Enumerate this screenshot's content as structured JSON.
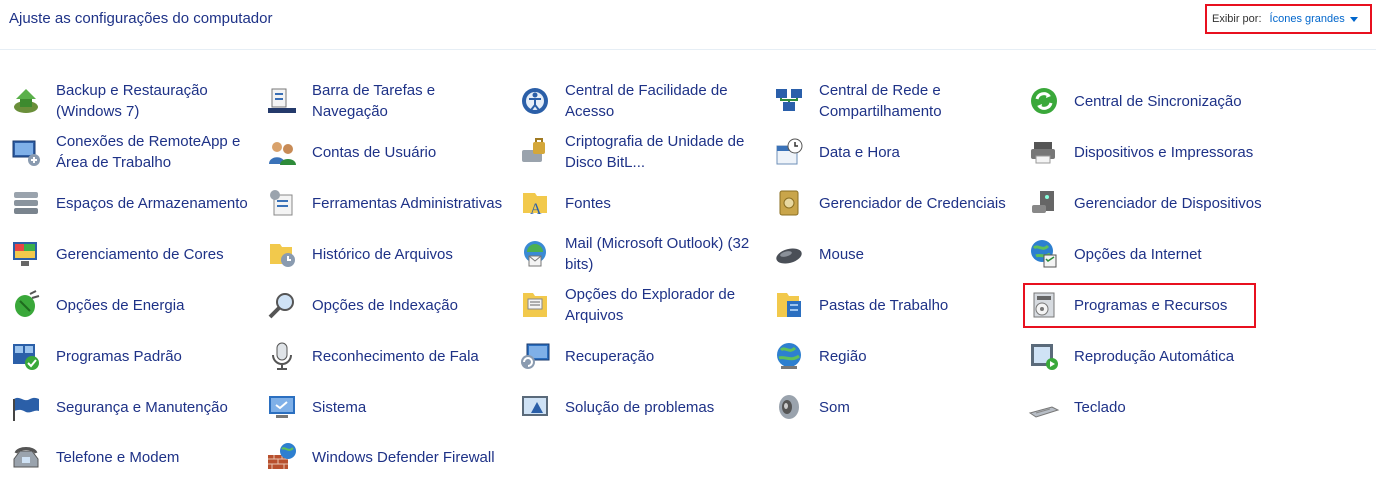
{
  "header": {
    "title": "Ajuste as configurações do computador",
    "view_label": "Exibir por:",
    "view_value": "Ícones grandes"
  },
  "items": [
    {
      "label": "Backup e Restauração (Windows 7)",
      "icon": "backup-restore-icon"
    },
    {
      "label": "Barra de Tarefas e Navegação",
      "icon": "taskbar-icon"
    },
    {
      "label": "Central de Facilidade de Acesso",
      "icon": "ease-of-access-icon"
    },
    {
      "label": "Central de Rede e Compartilhamento",
      "icon": "network-sharing-icon"
    },
    {
      "label": "Central de Sincronização",
      "icon": "sync-center-icon"
    },
    {
      "label": "Conexões de RemoteApp e Área de Trabalho",
      "icon": "remoteapp-icon"
    },
    {
      "label": "Contas de Usuário",
      "icon": "user-accounts-icon"
    },
    {
      "label": "Criptografia de Unidade de Disco BitL...",
      "icon": "bitlocker-icon"
    },
    {
      "label": "Data e Hora",
      "icon": "date-time-icon"
    },
    {
      "label": "Dispositivos e Impressoras",
      "icon": "devices-printers-icon"
    },
    {
      "label": "Espaços de Armazenamento",
      "icon": "storage-spaces-icon"
    },
    {
      "label": "Ferramentas Administrativas",
      "icon": "admin-tools-icon"
    },
    {
      "label": "Fontes",
      "icon": "fonts-icon"
    },
    {
      "label": "Gerenciador de Credenciais",
      "icon": "credential-manager-icon"
    },
    {
      "label": "Gerenciador de Dispositivos",
      "icon": "device-manager-icon"
    },
    {
      "label": "Gerenciamento de Cores",
      "icon": "color-management-icon"
    },
    {
      "label": "Histórico de Arquivos",
      "icon": "file-history-icon"
    },
    {
      "label": "Mail (Microsoft Outlook) (32 bits)",
      "icon": "mail-icon"
    },
    {
      "label": "Mouse",
      "icon": "mouse-icon"
    },
    {
      "label": "Opções da Internet",
      "icon": "internet-options-icon"
    },
    {
      "label": "Opções de Energia",
      "icon": "power-options-icon"
    },
    {
      "label": "Opções de Indexação",
      "icon": "indexing-options-icon"
    },
    {
      "label": "Opções do Explorador de Arquivos",
      "icon": "explorer-options-icon"
    },
    {
      "label": "Pastas de Trabalho",
      "icon": "work-folders-icon"
    },
    {
      "label": "Programas e Recursos",
      "icon": "programs-features-icon"
    },
    {
      "label": "Programas Padrão",
      "icon": "default-programs-icon"
    },
    {
      "label": "Reconhecimento de Fala",
      "icon": "speech-recognition-icon"
    },
    {
      "label": "Recuperação",
      "icon": "recovery-icon"
    },
    {
      "label": "Região",
      "icon": "region-icon"
    },
    {
      "label": "Reprodução Automática",
      "icon": "autoplay-icon"
    },
    {
      "label": "Segurança e Manutenção",
      "icon": "security-maintenance-icon"
    },
    {
      "label": "Sistema",
      "icon": "system-icon"
    },
    {
      "label": "Solução de problemas",
      "icon": "troubleshooting-icon"
    },
    {
      "label": "Som",
      "icon": "sound-icon"
    },
    {
      "label": "Teclado",
      "icon": "keyboard-icon"
    },
    {
      "label": "Telefone e Modem",
      "icon": "phone-modem-icon"
    },
    {
      "label": "Windows Defender Firewall",
      "icon": "firewall-icon"
    }
  ]
}
